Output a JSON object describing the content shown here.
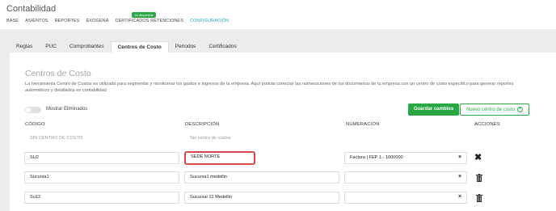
{
  "app": {
    "title": "Contabilidad"
  },
  "nav": [
    "BASE",
    "ASIENTOS",
    "REPORTES",
    "EXOGENA",
    "CERTIFICADOS RETENCIONES",
    "CONFIGURACIÓN"
  ],
  "badge": "Ya disponible",
  "tabs": [
    "Reglas",
    "PUC",
    "Comprobantes",
    "Centros de Costo",
    "Periodos",
    "Certificados"
  ],
  "active_tab": "Centros de Costo",
  "section": {
    "title": "Centros de Costo",
    "description": "La herramienta Centro de Costos es utilizada para segmentar y monitorear los gastos e ingresos de la empresa. Aquí podrás conectar las numeraciones de los documentos de tu empresa con un centro de costo específico para generar reportes automáticos y detallados en contabilidad"
  },
  "toggle": {
    "label": "Mostrar Eliminados",
    "checked": false
  },
  "buttons": {
    "save": "Guardar cambios",
    "new": "Nuevo centro de costo"
  },
  "columns": {
    "code": "CÓDIGO",
    "description": "DESCRIPCIÓN",
    "numbering": "NUMERACIÓN",
    "actions": "ACCIONES"
  },
  "default_row": {
    "code": "SIN CENTRO DE COSTO",
    "description": "Sin centro de costos"
  },
  "rows": [
    {
      "code": "SU2",
      "description": "SEDE NORTE",
      "numbering": "Factura | FEP 1 - 1000000",
      "action": "close-icon"
    },
    {
      "code": "Sucursa1",
      "description": "Sucursa1 medellin",
      "numbering": "",
      "action": "trash-icon"
    },
    {
      "code": "Su12",
      "description": "Sucursal 12 Medellin",
      "numbering": "",
      "action": "trash-icon"
    }
  ],
  "colors": {
    "accent": "#1aa7c7",
    "success": "#29a745",
    "highlight": "#d64848"
  }
}
